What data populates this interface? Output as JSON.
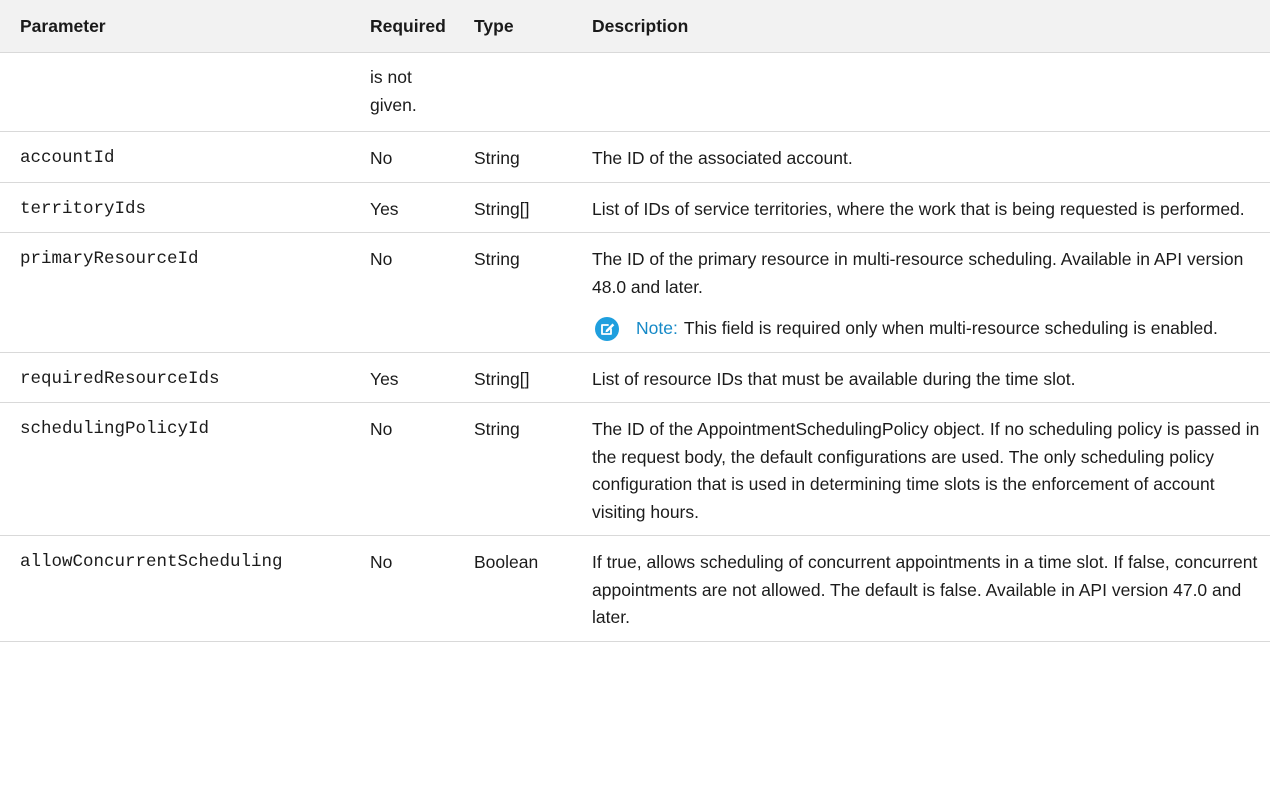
{
  "table": {
    "headers": {
      "parameter": "Parameter",
      "required": "Required",
      "type": "Type",
      "description": "Description"
    },
    "continuation": {
      "required": "is not given."
    },
    "rows": [
      {
        "parameter": "accountId",
        "required": "No",
        "type": "String",
        "description": "The ID of the associated account."
      },
      {
        "parameter": "territoryIds",
        "required": "Yes",
        "type": "String[]",
        "description": "List of IDs of service territories, where the work that is being requested is performed."
      },
      {
        "parameter": "primaryResourceId",
        "required": "No",
        "type": "String",
        "description": "The ID of the primary resource in multi-resource scheduling. Available in API version 48.0 and later.",
        "note_label": "Note:",
        "note_text": "This field is required only when multi-resource scheduling is enabled."
      },
      {
        "parameter": "requiredResourceIds",
        "required": "Yes",
        "type": "String[]",
        "description": "List of resource IDs that must be available during the time slot."
      },
      {
        "parameter": "schedulingPolicyId",
        "required": "No",
        "type": "String",
        "description": "The ID of the AppointmentSchedulingPolicy object. If no scheduling policy is passed in the request body, the default configurations are used. The only scheduling policy configuration that is used in determining time slots is the enforcement of account visiting hours."
      },
      {
        "parameter": "allowConcurrentScheduling",
        "required": "No",
        "type": "Boolean",
        "description": "If true, allows scheduling of concurrent appointments in a time slot. If false, concurrent appointments are not allowed. The default is false. Available in API version 47.0 and later."
      }
    ]
  },
  "colors": {
    "header_bg": "#f2f2f2",
    "border": "#d9d9d9",
    "note_accent": "#1589c7",
    "note_icon": "#1f9fde"
  },
  "icons": {
    "note": "edit-note-icon"
  }
}
